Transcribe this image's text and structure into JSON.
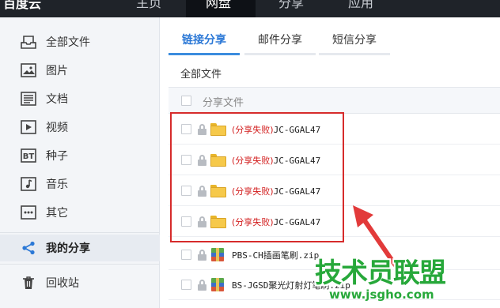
{
  "topbar": {
    "logo": "百度云",
    "nav": [
      "主页",
      "网盘",
      "分享",
      "应用"
    ],
    "active_index": 1
  },
  "sidebar": {
    "items": [
      {
        "label": "全部文件",
        "icon": "files-icon"
      },
      {
        "label": "图片",
        "icon": "image-icon"
      },
      {
        "label": "文档",
        "icon": "document-icon"
      },
      {
        "label": "视频",
        "icon": "video-icon"
      },
      {
        "label": "种子",
        "icon": "bt-icon",
        "icon_text": "BT"
      },
      {
        "label": "音乐",
        "icon": "music-icon"
      },
      {
        "label": "其它",
        "icon": "more-icon"
      },
      {
        "label": "我的分享",
        "icon": "share-icon",
        "active": true
      },
      {
        "label": "回收站",
        "icon": "trash-icon"
      }
    ]
  },
  "tabs": {
    "items": [
      "链接分享",
      "邮件分享",
      "短信分享"
    ],
    "active_index": 0
  },
  "breadcrumb": "全部文件",
  "table": {
    "header": "分享文件",
    "rows": [
      {
        "status": "(分享失败)",
        "name": "JC-GGAL47",
        "type": "folder",
        "locked": true
      },
      {
        "status": "(分享失败)",
        "name": "JC-GGAL47",
        "type": "folder",
        "locked": true
      },
      {
        "status": "(分享失败)",
        "name": "JC-GGAL47",
        "type": "folder",
        "locked": true
      },
      {
        "status": "(分享失败)",
        "name": "JC-GGAL47",
        "type": "folder",
        "locked": true
      },
      {
        "status": "",
        "name": "PBS-CH插画笔刷.zip",
        "type": "zip",
        "locked": true
      },
      {
        "status": "",
        "name": "BS-JGSD聚光灯射灯笔刷.zip",
        "type": "zip",
        "locked": true
      }
    ]
  },
  "watermark": {
    "title": "技术员联盟",
    "url": "www.jsgho.com"
  },
  "colors": {
    "accent": "#2b78d6",
    "fail": "#d21d1d",
    "highlight": "#d62b2b",
    "watermark": "#27a83a"
  }
}
